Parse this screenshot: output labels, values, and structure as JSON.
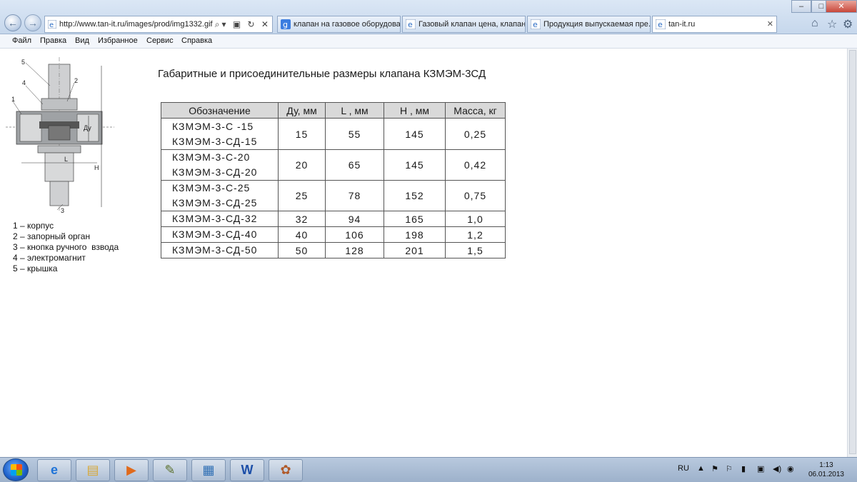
{
  "browser": {
    "address": "http://www.tan-it.ru/images/prod/img1332.gif",
    "tabs": [
      {
        "label": "клапан на газовое оборудова..."
      },
      {
        "label": "Газовый клапан цена, клапан..."
      },
      {
        "label": "Продукция выпускаемая пре..."
      },
      {
        "label": "tan-it.ru"
      }
    ],
    "menu": [
      "Файл",
      "Правка",
      "Вид",
      "Избранное",
      "Сервис",
      "Справка"
    ],
    "window_controls": [
      "–",
      "□",
      "✕"
    ]
  },
  "document": {
    "title": "Габаритные и присоединительные размеры клапана КЗМЭМ-3СД",
    "diagram_labels": {
      "n1": "1",
      "n2": "2",
      "n3": "3",
      "n4": "4",
      "n5": "5",
      "du": "Ду",
      "l": "L",
      "h": "H"
    },
    "legend": [
      "1 – корпус",
      "2 – запорный орган",
      "3 – кнопка ручного  взвода",
      "4 – электромагнит",
      "5 – крышка"
    ],
    "table": {
      "headers": [
        "Обозначение",
        "Ду, мм",
        "L , мм",
        "Н , мм",
        "Масса, кг"
      ],
      "rows": [
        {
          "des1": "КЗМЭМ-3-С -15",
          "des2": "КЗМЭМ-3-СД-15",
          "du": "15",
          "l": "55",
          "h": "145",
          "mass": "0,25"
        },
        {
          "des1": "КЗМЭМ-3-С-20",
          "des2": "КЗМЭМ-3-СД-20",
          "du": "20",
          "l": "65",
          "h": "145",
          "mass": "0,42"
        },
        {
          "des1": "КЗМЭМ-3-С-25",
          "des2": "КЗМЭМ-3-СД-25",
          "du": "25",
          "l": "78",
          "h": "152",
          "mass": "0,75"
        },
        {
          "des1": "КЗМЭМ-3-СД-32",
          "du": "32",
          "l": "94",
          "h": "165",
          "mass": "1,0"
        },
        {
          "des1": "КЗМЭМ-3-СД-40",
          "du": "40",
          "l": "106",
          "h": "198",
          "mass": "1,2"
        },
        {
          "des1": "КЗМЭМ-3-СД-50",
          "du": "50",
          "l": "128",
          "h": "201",
          "mass": "1,5"
        }
      ]
    }
  },
  "taskbar": {
    "language": "RU",
    "time": "1:13",
    "date": "06.01.2013"
  },
  "colors": {
    "table_header_bg": "#d9d9d9",
    "titlebar": "#c6d7ec",
    "taskbar": "#9db1cb"
  }
}
